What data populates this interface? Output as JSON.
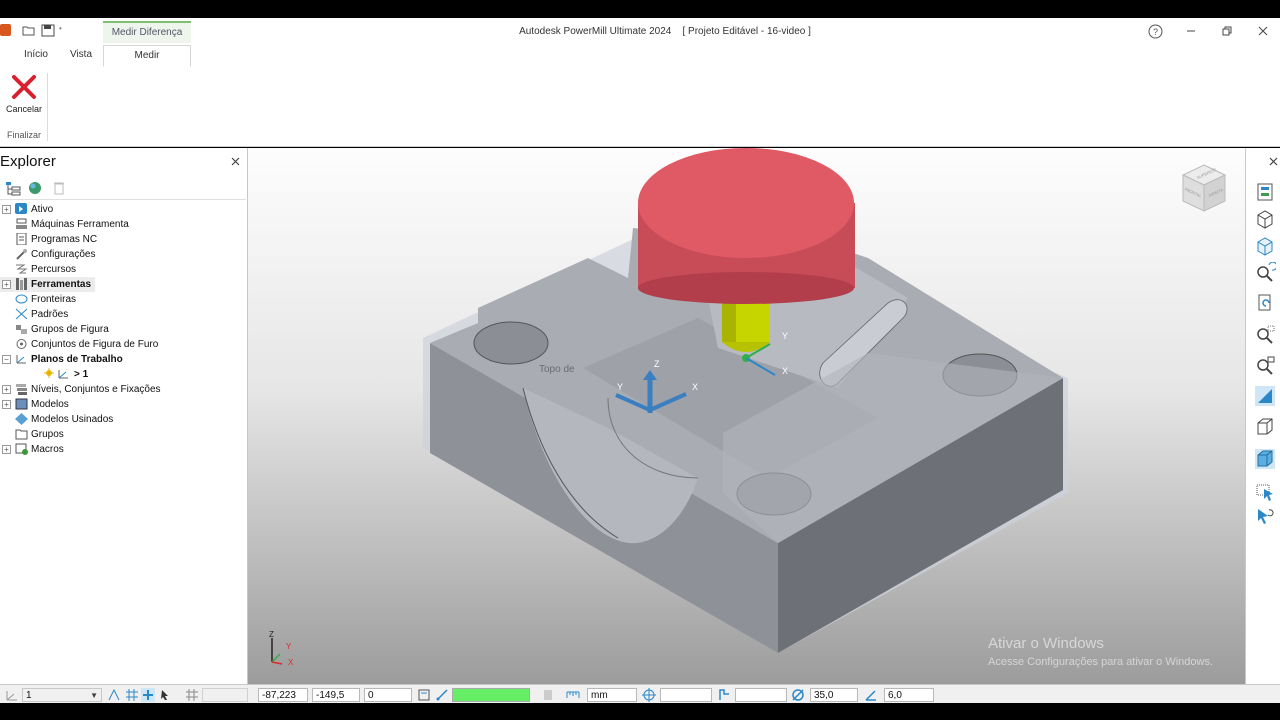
{
  "window": {
    "app_title": "Autodesk PowerMill Ultimate 2024",
    "project": "[ Projeto Editável - 16-video ]",
    "help_icon": "help-icon",
    "minimize_icon": "minimize-icon",
    "restore_icon": "restore-icon",
    "close_icon": "close-icon"
  },
  "ribbon": {
    "context_tab_group": "Medir Diferença",
    "tabs": [
      {
        "label": "Início"
      },
      {
        "label": "Vista"
      },
      {
        "label": "Medir"
      }
    ],
    "cancel_label": "Cancelar",
    "group_label": "Finalizar"
  },
  "explorer": {
    "title": "Explorer",
    "items": [
      {
        "label": "Ativo",
        "bold": false,
        "icon": "active-icon"
      },
      {
        "label": "Máquinas Ferramenta",
        "bold": false,
        "icon": "machine-tool-icon"
      },
      {
        "label": "Programas NC",
        "bold": false,
        "icon": "nc-program-icon"
      },
      {
        "label": "Configurações",
        "bold": false,
        "icon": "settings-icon"
      },
      {
        "label": "Percursos",
        "bold": false,
        "icon": "toolpath-icon"
      },
      {
        "label": "Ferramentas",
        "bold": true,
        "icon": "tools-icon"
      },
      {
        "label": "Fronteiras",
        "bold": false,
        "icon": "boundary-icon"
      },
      {
        "label": "Padrões",
        "bold": false,
        "icon": "pattern-icon"
      },
      {
        "label": "Grupos de Figura",
        "bold": false,
        "icon": "feature-group-icon"
      },
      {
        "label": "Conjuntos de Figura de Furo",
        "bold": false,
        "icon": "hole-feature-icon"
      },
      {
        "label": "Planos de Trabalho",
        "bold": true,
        "icon": "workplane-icon"
      },
      {
        "label": "> 1",
        "bold": true,
        "icon": "workplane-child-icon"
      },
      {
        "label": "Níveis, Conjuntos e Fixações",
        "bold": false,
        "icon": "levels-icon"
      },
      {
        "label": "Modelos",
        "bold": false,
        "icon": "model-icon"
      },
      {
        "label": "Modelos Usinados",
        "bold": false,
        "icon": "stock-model-icon"
      },
      {
        "label": "Grupos",
        "bold": false,
        "icon": "group-icon"
      },
      {
        "label": "Macros",
        "bold": false,
        "icon": "macro-icon"
      }
    ]
  },
  "viewport": {
    "workplane_label": "Topo de",
    "axis_labels": {
      "z": "Z",
      "y": "Y",
      "x": "X"
    },
    "tool_axis_labels": {
      "y": "Y",
      "x": "X"
    },
    "triad_labels": {
      "z": "Z",
      "y": "Y",
      "x": "X"
    },
    "viewcube_faces": {
      "top": "SUPERIOR",
      "front": "FRONTAL",
      "right": "DIREITA"
    },
    "watermark_title": "Ativar o Windows",
    "watermark_sub": "Acesse Configurações para ativar o Windows."
  },
  "statusbar": {
    "workplane_value": "1",
    "x_value": "-87,223",
    "y_value": "-149,5",
    "z_value": "0",
    "units": "mm",
    "diameter_value": "35,0",
    "angle_value": "6,0"
  },
  "colors": {
    "tool_holder": "#e05a66",
    "tool_shank": "#c6d400",
    "part_gray": "#8c8f96",
    "status_green": "#66ee66",
    "accent_blue": "#2a88c8"
  }
}
